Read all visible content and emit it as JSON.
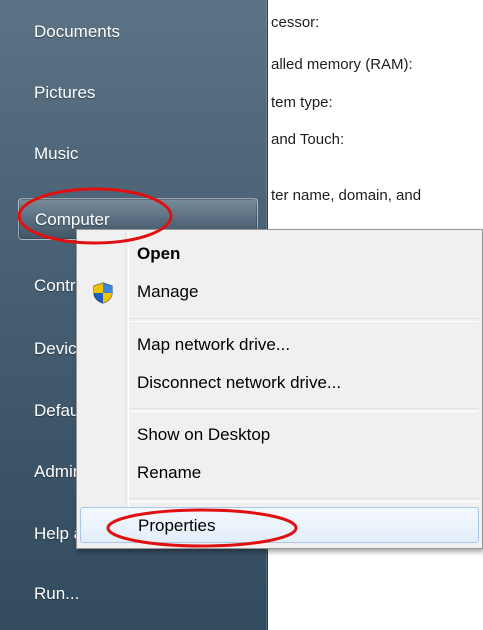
{
  "start_menu": {
    "items": [
      {
        "label": "Documents"
      },
      {
        "label": "Pictures"
      },
      {
        "label": "Music"
      },
      {
        "label": "Computer"
      },
      {
        "label": "Control Panel"
      },
      {
        "label": "Devices and Printers"
      },
      {
        "label": "Default Programs"
      },
      {
        "label": "Administrative Tools"
      },
      {
        "label": "Help and Support"
      },
      {
        "label": "Run..."
      }
    ],
    "selected": "Computer"
  },
  "system_info": {
    "lines": [
      "cessor:",
      "alled memory (RAM):",
      "tem type:",
      " and Touch:",
      "ter name, domain, and"
    ]
  },
  "context_menu": {
    "items": [
      {
        "label": "Open",
        "bold": true
      },
      {
        "label": "Manage",
        "icon": "uac-shield-icon"
      },
      {
        "label": "Map network drive..."
      },
      {
        "label": "Disconnect network drive..."
      },
      {
        "label": "Show on Desktop"
      },
      {
        "label": "Rename"
      },
      {
        "label": "Properties",
        "highlighted": true
      }
    ]
  },
  "colors": {
    "start_pane_top": "#5c7385",
    "start_pane_bottom": "#324b5e",
    "menu_background": "#f0f0f0",
    "annotation": "#e01010"
  }
}
